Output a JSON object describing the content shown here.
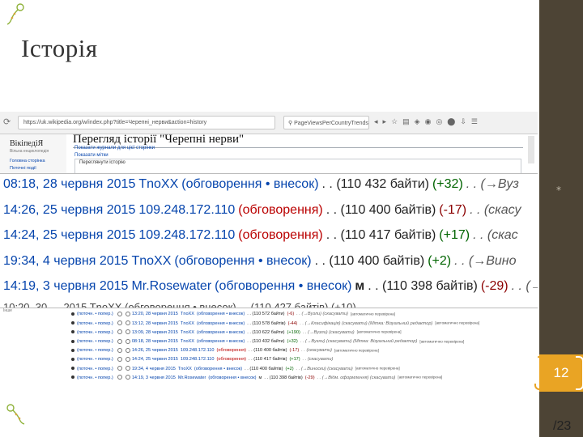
{
  "slide": {
    "title": "Історія",
    "page_number": "12",
    "total_pages": "/23",
    "side_mark": "*"
  },
  "browser": {
    "url": "https://uk.wikipedia.org/w/index.php?title=Черепні_нерви&action=history",
    "search_text": "PageViewsPerCountryTrends",
    "toolbar_icons": [
      "dropdown-icon",
      "back-icon",
      "forward-icon",
      "bookmark-star-icon",
      "reader-icon",
      "shield-icon",
      "pocket-icon",
      "extension-icon",
      "addon-icon",
      "download-icon",
      "menu-icon"
    ]
  },
  "wiki": {
    "logo": "ВікіпедіЯ",
    "logo_sub": "Вільна енциклопедія",
    "side_links": [
      "Головна сторінка",
      "Поточні події"
    ],
    "heading": "Перегляд історії \"Черепні нерви\"",
    "log_link": "Показати журнали для цієї сторінки",
    "tag_link": "Показати мітки",
    "fieldset_legend": "Переглянути історію"
  },
  "zoomed_rows": [
    {
      "time": "08:18, 28 червня 2015",
      "user": "TnoXX",
      "user_link": true,
      "talk": "(обговорення • внесок)",
      "talk_red": false,
      "marker": "",
      "size": ". . (110 432 байти)",
      "diff": "(+32)",
      "diff_sign": "pos",
      "tail": ". . (→Вуз"
    },
    {
      "time": "14:26, 25 червня 2015",
      "user": "109.248.172.110",
      "user_link": true,
      "talk": "(обговорення)",
      "talk_red": true,
      "marker": "",
      "size": ". . (110 400 байтів)",
      "diff": "(-17)",
      "diff_sign": "neg",
      "tail": ". . (скасу"
    },
    {
      "time": "14:24, 25 червня 2015",
      "user": "109.248.172.110",
      "user_link": true,
      "talk": "(обговорення)",
      "talk_red": true,
      "marker": "",
      "size": ". . (110 417 байтів)",
      "diff": "(+17)",
      "diff_sign": "pos",
      "tail": ". . (скас"
    },
    {
      "time": "19:34, 4 червня 2015",
      "user": "TnoXX",
      "user_link": true,
      "talk": "(обговорення • внесок)",
      "talk_red": false,
      "marker": "",
      "size": ". . (110 400 байтів)",
      "diff": "(+2)",
      "diff_sign": "pos",
      "tail": ". . (→Вино"
    },
    {
      "time": "14:19, 3 червня 2015",
      "user": "Mr.Rosewater",
      "user_link": true,
      "talk": "(обговорення • внесок)",
      "talk_red": false,
      "marker": "м",
      "size": ". . (110 398 байтів)",
      "diff": "(-29)",
      "diff_sign": "neg",
      "tail": ". . (→"
    }
  ],
  "zoomed_partial": "10:20, 30 … 2015  TnoXX (обговорення • внесок) . . (110 427 байтів) (+10) . .",
  "history_side_text": "Інше",
  "history_rows": [
    {
      "cmp": "(поточн. • попер.)",
      "time": "13:20, 28 червня 2015",
      "user": "TnoXX",
      "talk": "(обговорення • внесок)",
      "marker": "",
      "size": ". . (110 572 байти)",
      "diff": "(-6)",
      "diff_sign": "neg",
      "summary": ". . (→Вузли) (скасувати)",
      "tag": "[автоматично перевірена]"
    },
    {
      "cmp": "(поточн. • попер.)",
      "time": "13:12, 28 червня 2015",
      "user": "TnoXX",
      "talk": "(обговорення • внесок)",
      "marker": "",
      "size": ". . (110 578 байтів)",
      "diff": "(-44)",
      "diff_sign": "neg",
      "summary": ". . (→Класифікація) (скасувати) (Мітка: Візуальний редактор)",
      "tag": "[автоматично перевірена]"
    },
    {
      "cmp": "(поточн. • попер.)",
      "time": "13:09, 28 червня 2015",
      "user": "TnoXX",
      "talk": "(обговорення • внесок)",
      "marker": "",
      "size": ". . (110 622 байти)",
      "diff": "(+190)",
      "diff_sign": "pos",
      "summary": ". . (→Вузли) (скасувати)",
      "tag": "[автоматично перевірена]"
    },
    {
      "cmp": "(поточн. • попер.)",
      "time": "08:18, 28 червня 2015",
      "user": "TnoXX",
      "talk": "(обговорення • внесок)",
      "marker": "",
      "size": ". . (110 432 байти)",
      "diff": "(+32)",
      "diff_sign": "pos",
      "summary": ". . (→Вузли) (скасувати) (Мітка: Візуальний редактор)",
      "tag": "[автоматично перевірена]"
    },
    {
      "cmp": "(поточн. • попер.)",
      "time": "14:26, 25 червня 2015",
      "user": "109.248.172.110",
      "talk": "(обговорення)",
      "marker": "",
      "size": ". . (110 400 байтів)",
      "diff": "(-17)",
      "diff_sign": "neg",
      "summary": ". . (скасувати)",
      "tag": "[автоматично перевірена]"
    },
    {
      "cmp": "(поточн. • попер.)",
      "time": "14:24, 25 червня 2015",
      "user": "109.248.172.110",
      "talk": "(обговорення)",
      "marker": "",
      "size": ". . (110 417 байтів)",
      "diff": "(+17)",
      "diff_sign": "pos",
      "summary": ". . (скасувати)",
      "tag": ""
    },
    {
      "cmp": "(поточн. • попер.)",
      "time": "19:34, 4 червня 2015",
      "user": "TnoXX",
      "talk": "(обговорення • внесок)",
      "marker": "",
      "size": ". . (110 400 байтів)",
      "diff": "(+2)",
      "diff_sign": "pos",
      "summary": ". . (→Виноски) (скасувати)",
      "tag": "[автоматично перевірена]"
    },
    {
      "cmp": "(поточн. • попер.)",
      "time": "14:19, 3 червня 2015",
      "user": "Mr.Rosewater",
      "talk": "(обговорення • внесок)",
      "marker": "м",
      "size": ". . (110 398 байтів)",
      "diff": "(-29)",
      "diff_sign": "neg",
      "summary": ". . (→Відм. оформлення) (скасувати)",
      "tag": "[автоматично перевірена]"
    }
  ],
  "colors": {
    "side_band": "#4d4435",
    "page_box": "#e9a424",
    "link": "#0645ad",
    "redlink": "#ba0000",
    "positive": "#006400",
    "negative": "#8b0000"
  }
}
